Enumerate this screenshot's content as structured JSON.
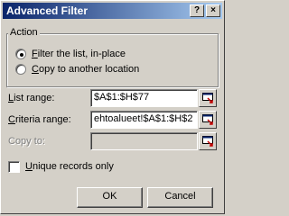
{
  "window": {
    "title": "Advanced Filter",
    "help_glyph": "?",
    "close_glyph": "×"
  },
  "action": {
    "group_label": "Action",
    "options": [
      {
        "label_key": "F",
        "label_rest": "ilter the list, in-place",
        "selected": true
      },
      {
        "label_key": "C",
        "label_rest": "opy to another location",
        "selected": false
      }
    ]
  },
  "fields": {
    "list_range": {
      "label_key": "L",
      "label_rest": "ist range:",
      "value": "$A$1:$H$77"
    },
    "criteria_range": {
      "label_key": "C",
      "label_rest": "riteria range:",
      "value": "ehtoalueet!$A$1:$H$2"
    },
    "copy_to": {
      "label_key": "",
      "label_rest": "Copy to:",
      "value": "",
      "disabled": true
    }
  },
  "unique": {
    "label_key": "U",
    "label_rest": "nique records only",
    "checked": false
  },
  "buttons": {
    "ok": "OK",
    "cancel": "Cancel"
  },
  "icons": {
    "collapse": "collapse-dialog-icon"
  }
}
